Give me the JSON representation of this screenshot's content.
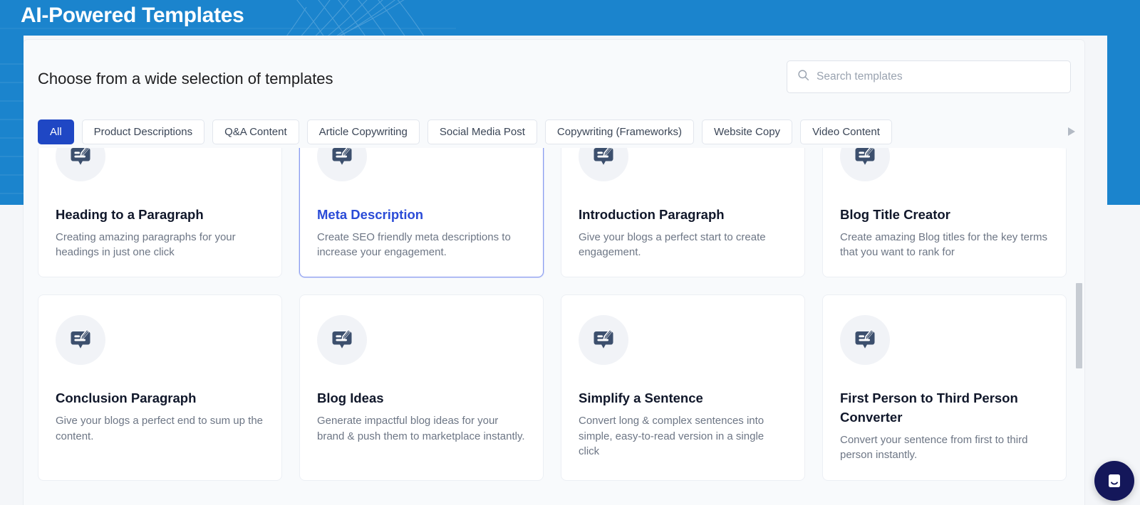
{
  "header": {
    "title": "AI-Powered Templates",
    "brand_blue": "#1b84cd"
  },
  "panel": {
    "heading": "Choose from a wide selection of templates"
  },
  "search": {
    "icon": "search-icon",
    "value": "",
    "placeholder": "Search templates"
  },
  "tabs": {
    "active_index": 0,
    "next_icon": "chevron-right-icon",
    "accent": "#1f47c4",
    "items": [
      {
        "label": "All"
      },
      {
        "label": "Product Descriptions"
      },
      {
        "label": "Q&A Content"
      },
      {
        "label": "Article Copywriting"
      },
      {
        "label": "Social Media Post"
      },
      {
        "label": "Copywriting (Frameworks)"
      },
      {
        "label": "Website Copy"
      },
      {
        "label": "Video Content"
      }
    ]
  },
  "cards": {
    "icon": "template-edit-icon",
    "selected_index": 1,
    "selected_color": "#2a4bd7",
    "items": [
      {
        "title": "Heading to a Paragraph",
        "description": "Creating amazing paragraphs for your headings in just one click"
      },
      {
        "title": "Meta Description",
        "description": "Create SEO friendly meta descriptions to increase your engagement."
      },
      {
        "title": "Introduction Paragraph",
        "description": "Give your blogs a perfect start to create engagement."
      },
      {
        "title": "Blog Title Creator",
        "description": "Create amazing Blog titles for the key terms that you want to rank for"
      },
      {
        "title": "Conclusion Paragraph",
        "description": "Give your blogs a perfect end to sum up the content."
      },
      {
        "title": "Blog Ideas",
        "description": "Generate impactful blog ideas for your brand & push them to marketplace instantly."
      },
      {
        "title": "Simplify a Sentence",
        "description": "Convert long & complex sentences into simple, easy-to-read version in a single click"
      },
      {
        "title": "First Person to Third Person Converter",
        "description": "Convert your sentence from first to third person instantly."
      }
    ]
  },
  "chat": {
    "icon": "intercom-chat-icon",
    "color": "#14175a"
  },
  "scrollbar": {
    "name": "cards-vertical-scrollbar"
  }
}
